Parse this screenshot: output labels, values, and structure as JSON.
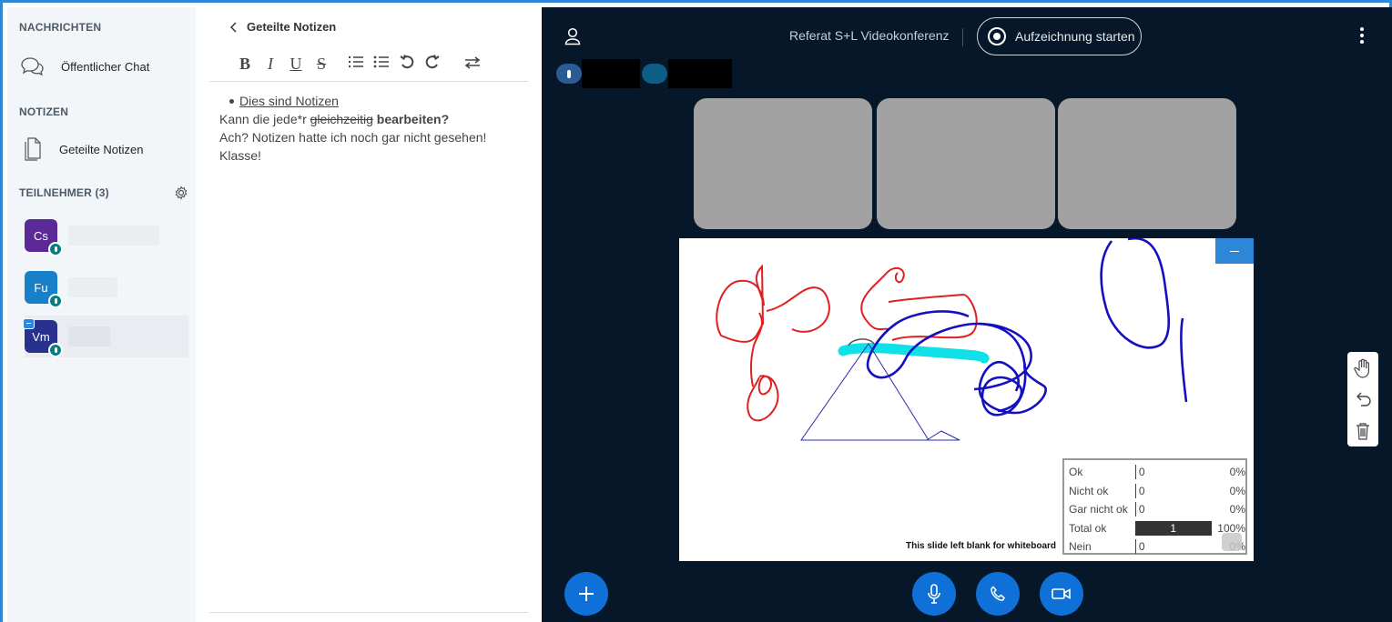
{
  "sidebar": {
    "messages_title": "NACHRICHTEN",
    "public_chat_label": "Öffentlicher Chat",
    "notes_title": "NOTIZEN",
    "shared_notes_label": "Geteilte Notizen",
    "participants_title": "TEILNEHMER (3)",
    "users": [
      {
        "initials": "Cs",
        "color": "#5b2a96"
      },
      {
        "initials": "Fu",
        "color": "#1780c9"
      },
      {
        "initials": "Vm",
        "color": "#28328e"
      }
    ]
  },
  "notes": {
    "back_label": "Geteilte Notizen",
    "toolbar": {
      "bold": "B",
      "italic": "I",
      "underline": "U",
      "strike": "S"
    },
    "line1": "Dies sind Notizen",
    "line2_a": "Kann die jede*r ",
    "line2_strike": "gleichzeitig",
    "line2_bold": " bearbeiten?",
    "line3": "Ach? Notizen hatte ich noch gar nicht gesehen!",
    "line4": "Klasse!"
  },
  "main": {
    "conference_title": "Referat S+L Videokonferenz",
    "record_label": "Aufzeichnung starten"
  },
  "whiteboard": {
    "caption": "This slide left blank for whiteboard",
    "poll": [
      {
        "label": "Ok",
        "count": "0",
        "percent": "0%"
      },
      {
        "label": "Nicht ok",
        "count": "0",
        "percent": "0%"
      },
      {
        "label": "Gar nicht ok",
        "count": "0",
        "percent": "0%"
      },
      {
        "label": "Total ok",
        "count": "1",
        "percent": "100%"
      },
      {
        "label": "Nein",
        "count": "0",
        "percent": "0%"
      }
    ]
  },
  "colors": {
    "accent": "#0f70d7",
    "main_bg": "#06172a",
    "sidebar_bg": "#f3f6f9"
  }
}
